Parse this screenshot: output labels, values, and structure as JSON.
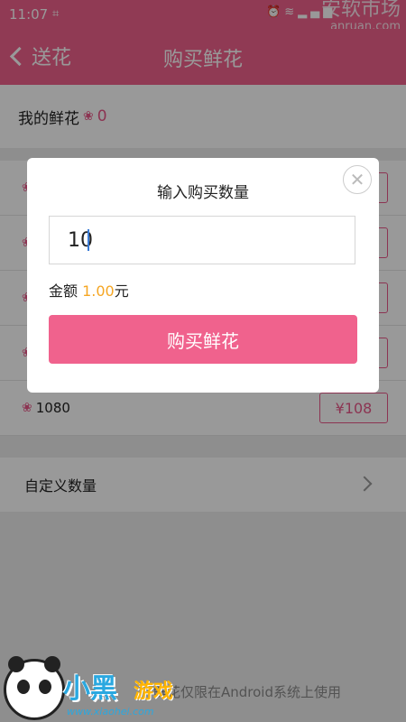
{
  "status_bar": {
    "time": "11:07",
    "icons": [
      "screenshot-icon",
      "alarm-icon",
      "wifi-icon",
      "signal-icon"
    ]
  },
  "watermark_top": {
    "name": "安软市场",
    "domain": "anruan.com"
  },
  "app_bar": {
    "back_label": "送花",
    "title": "购买鲜花"
  },
  "my_flowers": {
    "label": "我的鲜花",
    "count": "0"
  },
  "packages": [
    {
      "amount": "",
      "price": ""
    },
    {
      "amount": "",
      "price": ""
    },
    {
      "amount": "",
      "price": ""
    },
    {
      "amount": "",
      "price": ""
    },
    {
      "amount": "1080",
      "price": "¥108"
    }
  ],
  "custom": {
    "label": "自定义数量"
  },
  "footnote": "鲜花仅限在Android系统上使用",
  "dialog": {
    "title": "输入购买数量",
    "quantity_value": "10",
    "amount_label": "金额",
    "amount_value": "1.00",
    "amount_unit": "元",
    "buy_button": "购买鲜花",
    "close_symbol": "✕"
  },
  "watermark_bottom": {
    "brand": "小黑",
    "brand2": "游戏",
    "url": "www.xiaohei.com"
  },
  "colors": {
    "accent": "#f0628d",
    "amount": "#f5a623",
    "flower": "#e95889"
  }
}
